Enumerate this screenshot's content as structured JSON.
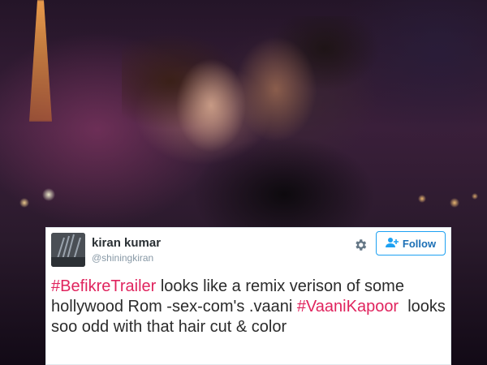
{
  "tweet": {
    "display_name": "kiran kumar",
    "screen_name": "@shiningkiran",
    "follow_label": "Follow",
    "text_parts": {
      "hashtag1": "#BefikreTrailer",
      "segment1": " looks like a remix verison of some hollywood Rom -sex-com's .vaani ",
      "hashtag2": "#VaaniKapoor",
      "segment2": "  looks soo odd with that hair cut & color"
    }
  },
  "colors": {
    "hashtag": "#e0245e",
    "follow_border": "#1da1f2",
    "follow_text": "#1b6fb5",
    "name": "#292f33",
    "handle": "#8899a6"
  },
  "icons": {
    "settings": "gear-icon",
    "follow": "add-user-icon",
    "avatar": "avatar"
  }
}
